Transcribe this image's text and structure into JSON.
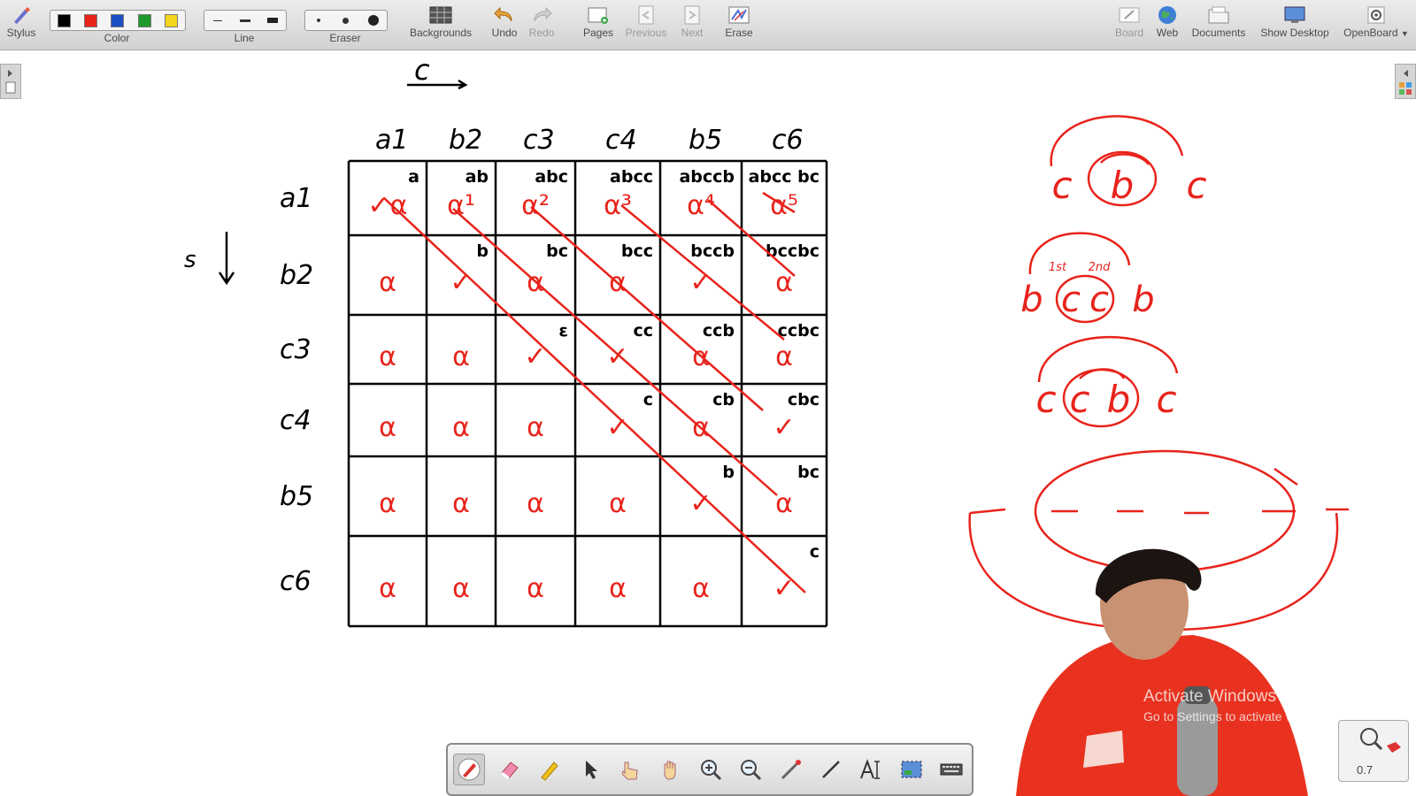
{
  "toolbar": {
    "stylus": "Stylus",
    "color": "Color",
    "line": "Line",
    "eraser": "Eraser",
    "backgrounds": "Backgrounds",
    "undo": "Undo",
    "redo": "Redo",
    "pages": "Pages",
    "previous": "Previous",
    "next": "Next",
    "erase": "Erase",
    "board": "Board",
    "web": "Web",
    "documents": "Documents",
    "show_desktop": "Show Desktop",
    "openboard": "OpenBoard"
  },
  "palette_colors": [
    "#000000",
    "#e8231b",
    "#1d4fc4",
    "#1e9a2a",
    "#f2d61b"
  ],
  "ink_color": "#e8231b",
  "board": {
    "top_mark": "c",
    "left_mark": "s",
    "col_headers": [
      "a1",
      "b2",
      "c3",
      "c4",
      "b5",
      "c6"
    ],
    "row_headers": [
      "a1",
      "b2",
      "c3",
      "c4",
      "b5",
      "c6"
    ],
    "cell_substrings": [
      [
        "a",
        "ab",
        "abc",
        "abcc",
        "abccb",
        "abcc bc"
      ],
      [
        "",
        "b",
        "bc",
        "bcc",
        "bccb",
        "bccbc"
      ],
      [
        "",
        "",
        "ε",
        "cc",
        "ccb",
        "ccbc"
      ],
      [
        "",
        "",
        "",
        "c",
        "cb",
        "cbc"
      ],
      [
        "",
        "",
        "",
        "",
        "b",
        "bc"
      ],
      [
        "",
        "",
        "",
        "",
        "",
        "c"
      ]
    ],
    "cell_marks": [
      [
        "✓α",
        "α¹",
        "α²",
        "α³",
        "α⁴",
        "α⁵"
      ],
      [
        "α",
        "✓",
        "α",
        "α",
        "✓",
        "α"
      ],
      [
        "α",
        "α",
        "✓",
        "✓",
        "α",
        "α"
      ],
      [
        "α",
        "α",
        "α",
        "✓",
        "α",
        "✓"
      ],
      [
        "α",
        "α",
        "α",
        "α",
        "✓",
        "α"
      ],
      [
        "α",
        "α",
        "α",
        "α",
        "α",
        "✓"
      ]
    ],
    "sketch1": [
      "c",
      "b",
      "c"
    ],
    "sketch2": [
      "b",
      "c",
      "c",
      "b"
    ],
    "sketch2_labels": [
      "1st",
      "2nd"
    ],
    "sketch3": [
      "c",
      "c",
      "b",
      "c"
    ]
  },
  "watermark": {
    "line1": "Activate Windows",
    "line2": "Go to Settings to activate Windows."
  },
  "zoom_value": "0.7"
}
